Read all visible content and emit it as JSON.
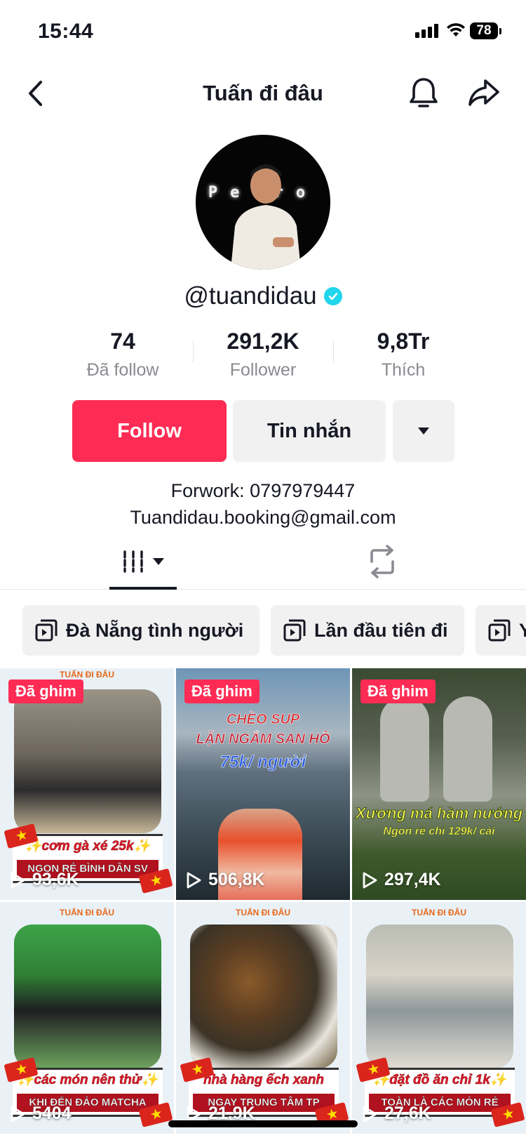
{
  "status_bar": {
    "time": "15:44",
    "battery": "78"
  },
  "header": {
    "title": "Tuấn đi đâu"
  },
  "profile": {
    "username": "@tuandidau",
    "avatar_text": "Pe   ro",
    "stats": [
      {
        "value": "74",
        "label": "Đã follow"
      },
      {
        "value": "291,2K",
        "label": "Follower"
      },
      {
        "value": "9,8Tr",
        "label": "Thích"
      }
    ],
    "follow_label": "Follow",
    "message_label": "Tin nhắn",
    "bio_line1": "Forwork: 0797979447",
    "bio_line2": "Tuandidau.booking@gmail.com"
  },
  "playlists": [
    {
      "label": "Đà Nẵng tình người"
    },
    {
      "label": "Lần đầu tiên đi"
    },
    {
      "label": "Y"
    }
  ],
  "videos": [
    {
      "pinned": "Đã ghim",
      "views": "93,6K",
      "brand": "TUẤN ĐI ĐÂU",
      "cap1": "✨cơm gà xé 25k✨",
      "cap2": "NGON RẺ BÌNH DÂN SV"
    },
    {
      "pinned": "Đã ghim",
      "views": "506,8K",
      "title1": "CHÈO SUP",
      "title2": "LẶN NGẮM SAN HÔ",
      "title3": "75k/ người"
    },
    {
      "pinned": "Đã ghim",
      "views": "297,4K",
      "title1": "Xương má hàm nướng",
      "title2": "Ngon rẻ chỉ 129k/ cái"
    },
    {
      "views": "5404",
      "brand": "TUẤN ĐI ĐÂU",
      "cap1": "✨các món nên thử✨",
      "cap2": "KHI ĐẾN ĐẢO MATCHA"
    },
    {
      "views": "21,9K",
      "brand": "TUẤN ĐI ĐÂU",
      "cap1": "nhà hàng ếch xanh",
      "cap2": "NGAY TRUNG TÂM TP"
    },
    {
      "views": "27,6K",
      "brand": "TUẤN ĐI ĐÂU",
      "cap1": "✨đặt đồ ăn chỉ 1k✨",
      "cap2": "TOÀN LÀ CÁC MÓN RẺ"
    }
  ],
  "colors": {
    "accent": "#fe2c55",
    "verified": "#20d5ec",
    "chip_bg": "#f1f1f2",
    "muted_text": "#8a8b91"
  }
}
